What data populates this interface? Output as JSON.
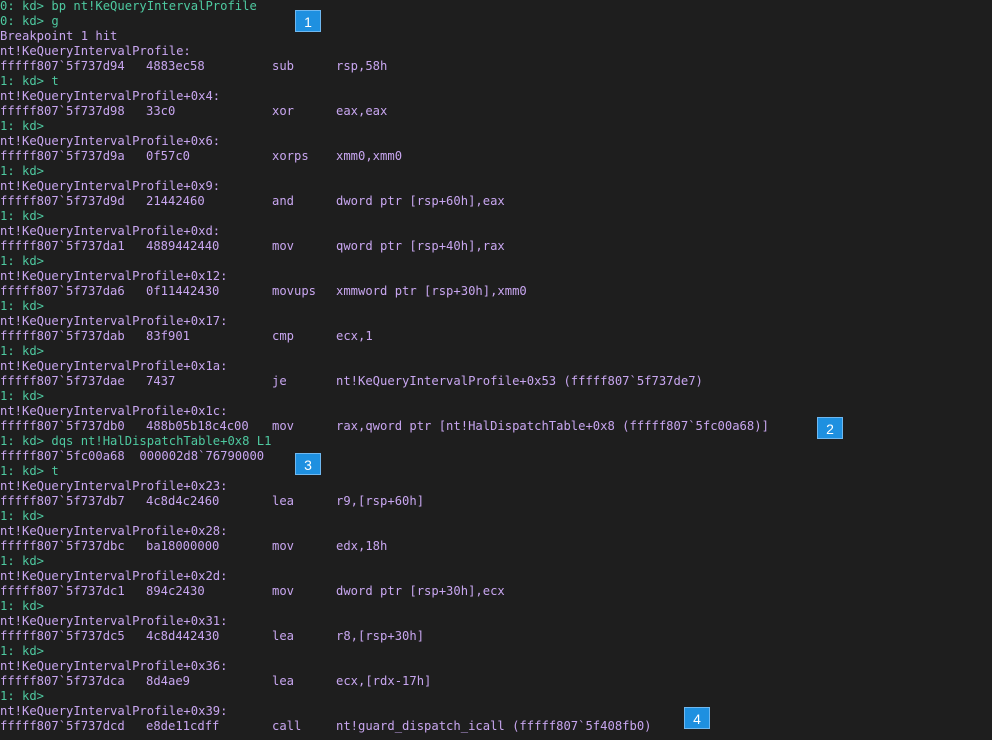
{
  "colors": {
    "background": "#1e1e1e",
    "prompt": "#4ec9a0",
    "output": "#c8a6f0",
    "badge": "#1e90e0"
  },
  "lines": [
    {
      "type": "prompt",
      "text": "0: kd> bp nt!KeQueryIntervalProfile"
    },
    {
      "type": "prompt",
      "text": "0: kd> g"
    },
    {
      "type": "text",
      "text": "Breakpoint 1 hit"
    },
    {
      "type": "text",
      "text": "nt!KeQueryIntervalProfile:"
    },
    {
      "type": "instr",
      "addr": "fffff807`5f737d94",
      "bytes": "4883ec58",
      "mnem": "sub",
      "ops": "rsp,58h"
    },
    {
      "type": "prompt",
      "text": "1: kd> t"
    },
    {
      "type": "text",
      "text": "nt!KeQueryIntervalProfile+0x4:"
    },
    {
      "type": "instr",
      "addr": "fffff807`5f737d98",
      "bytes": "33c0",
      "mnem": "xor",
      "ops": "eax,eax"
    },
    {
      "type": "prompt",
      "text": "1: kd>"
    },
    {
      "type": "text",
      "text": "nt!KeQueryIntervalProfile+0x6:"
    },
    {
      "type": "instr",
      "addr": "fffff807`5f737d9a",
      "bytes": "0f57c0",
      "mnem": "xorps",
      "ops": "xmm0,xmm0"
    },
    {
      "type": "prompt",
      "text": "1: kd>"
    },
    {
      "type": "text",
      "text": "nt!KeQueryIntervalProfile+0x9:"
    },
    {
      "type": "instr",
      "addr": "fffff807`5f737d9d",
      "bytes": "21442460",
      "mnem": "and",
      "ops": "dword ptr [rsp+60h],eax"
    },
    {
      "type": "prompt",
      "text": "1: kd>"
    },
    {
      "type": "text",
      "text": "nt!KeQueryIntervalProfile+0xd:"
    },
    {
      "type": "instr",
      "addr": "fffff807`5f737da1",
      "bytes": "4889442440",
      "mnem": "mov",
      "ops": "qword ptr [rsp+40h],rax"
    },
    {
      "type": "prompt",
      "text": "1: kd>"
    },
    {
      "type": "text",
      "text": "nt!KeQueryIntervalProfile+0x12:"
    },
    {
      "type": "instr",
      "addr": "fffff807`5f737da6",
      "bytes": "0f11442430",
      "mnem": "movups",
      "ops": "xmmword ptr [rsp+30h],xmm0"
    },
    {
      "type": "prompt",
      "text": "1: kd>"
    },
    {
      "type": "text",
      "text": "nt!KeQueryIntervalProfile+0x17:"
    },
    {
      "type": "instr",
      "addr": "fffff807`5f737dab",
      "bytes": "83f901",
      "mnem": "cmp",
      "ops": "ecx,1"
    },
    {
      "type": "prompt",
      "text": "1: kd>"
    },
    {
      "type": "text",
      "text": "nt!KeQueryIntervalProfile+0x1a:"
    },
    {
      "type": "instr",
      "addr": "fffff807`5f737dae",
      "bytes": "7437",
      "mnem": "je",
      "ops": "nt!KeQueryIntervalProfile+0x53 (fffff807`5f737de7)"
    },
    {
      "type": "prompt",
      "text": "1: kd>"
    },
    {
      "type": "text",
      "text": "nt!KeQueryIntervalProfile+0x1c:"
    },
    {
      "type": "instr",
      "addr": "fffff807`5f737db0",
      "bytes": "488b05b18c4c00",
      "mnem": "mov",
      "ops": "rax,qword ptr [nt!HalDispatchTable+0x8 (fffff807`5fc00a68)]"
    },
    {
      "type": "prompt",
      "text": "1: kd> dqs nt!HalDispatchTable+0x8 L1"
    },
    {
      "type": "text",
      "text": "fffff807`5fc00a68  000002d8`76790000"
    },
    {
      "type": "prompt",
      "text": "1: kd> t"
    },
    {
      "type": "text",
      "text": "nt!KeQueryIntervalProfile+0x23:"
    },
    {
      "type": "instr",
      "addr": "fffff807`5f737db7",
      "bytes": "4c8d4c2460",
      "mnem": "lea",
      "ops": "r9,[rsp+60h]"
    },
    {
      "type": "prompt",
      "text": "1: kd>"
    },
    {
      "type": "text",
      "text": "nt!KeQueryIntervalProfile+0x28:"
    },
    {
      "type": "instr",
      "addr": "fffff807`5f737dbc",
      "bytes": "ba18000000",
      "mnem": "mov",
      "ops": "edx,18h"
    },
    {
      "type": "prompt",
      "text": "1: kd>"
    },
    {
      "type": "text",
      "text": "nt!KeQueryIntervalProfile+0x2d:"
    },
    {
      "type": "instr",
      "addr": "fffff807`5f737dc1",
      "bytes": "894c2430",
      "mnem": "mov",
      "ops": "dword ptr [rsp+30h],ecx"
    },
    {
      "type": "prompt",
      "text": "1: kd>"
    },
    {
      "type": "text",
      "text": "nt!KeQueryIntervalProfile+0x31:"
    },
    {
      "type": "instr",
      "addr": "fffff807`5f737dc5",
      "bytes": "4c8d442430",
      "mnem": "lea",
      "ops": "r8,[rsp+30h]"
    },
    {
      "type": "prompt",
      "text": "1: kd>"
    },
    {
      "type": "text",
      "text": "nt!KeQueryIntervalProfile+0x36:"
    },
    {
      "type": "instr",
      "addr": "fffff807`5f737dca",
      "bytes": "8d4ae9",
      "mnem": "lea",
      "ops": "ecx,[rdx-17h]"
    },
    {
      "type": "prompt",
      "text": "1: kd>"
    },
    {
      "type": "text",
      "text": "nt!KeQueryIntervalProfile+0x39:"
    },
    {
      "type": "instr",
      "addr": "fffff807`5f737dcd",
      "bytes": "e8de11cdff",
      "mnem": "call",
      "ops": "nt!guard_dispatch_icall (fffff807`5f408fb0)"
    }
  ],
  "badges": [
    {
      "label": "1"
    },
    {
      "label": "2"
    },
    {
      "label": "3"
    },
    {
      "label": "4"
    }
  ]
}
